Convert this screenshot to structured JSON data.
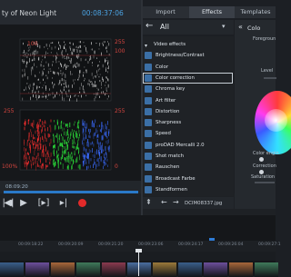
{
  "monitor": {
    "title": "ty of Neon Light",
    "timecode": "00:08:37:06",
    "progress_time": "08:09:20",
    "scale": {
      "top_left": "255",
      "top_left2": "100",
      "top_right": "255",
      "top_right2": "100",
      "mid_left": "255",
      "mid_right": "255",
      "bottom_left": "100%",
      "bottom_right": "0",
      "bottom_right2": "255"
    }
  },
  "transport": {
    "buttons": [
      "|◀",
      "◀|",
      "▶",
      "[▸]",
      "▸|"
    ],
    "record_color": "#e22a2a"
  },
  "tabs": [
    "Import",
    "Effects",
    "Templates"
  ],
  "effects_list": {
    "filter_label": "All",
    "items": [
      {
        "label": "Video effects",
        "type": "folder"
      },
      {
        "label": "Brightness/Contrast",
        "type": "effect"
      },
      {
        "label": "Color",
        "type": "effect"
      },
      {
        "label": "Color correction",
        "type": "effect",
        "selected": true
      },
      {
        "label": "Chroma key",
        "type": "effect"
      },
      {
        "label": "Art filter",
        "type": "effect"
      },
      {
        "label": "Distortion",
        "type": "effect"
      },
      {
        "label": "Sharpness",
        "type": "effect"
      },
      {
        "label": "Speed",
        "type": "effect"
      },
      {
        "label": "proDAD Mercalli 2.0",
        "type": "effect"
      },
      {
        "label": "Shot match",
        "type": "effect"
      },
      {
        "label": "Rauschen",
        "type": "effect"
      },
      {
        "label": "Broadcast Farbe",
        "type": "effect"
      },
      {
        "label": "Standformen",
        "type": "effect"
      }
    ],
    "footer_file": "DCIM08337.jpg"
  },
  "right_panel": {
    "title": "Colo",
    "foreground_label": "Foregroun",
    "level_label": "Level",
    "color_engine": "Color engin",
    "correction": "Correction",
    "saturation": "Saturation"
  },
  "timeline": {
    "ticks": [
      "00:09:18:22",
      "00:09:20:09",
      "00:09:21:20",
      "00:09:23:06",
      "00:09:24:17",
      "00:09:26:04",
      "00:09:27:1"
    ],
    "head_label": "00:09:..."
  },
  "colors": {
    "accent": "#2a79c8",
    "timecode": "#4ba3e3",
    "selected_outline": "#c9d0d8"
  }
}
